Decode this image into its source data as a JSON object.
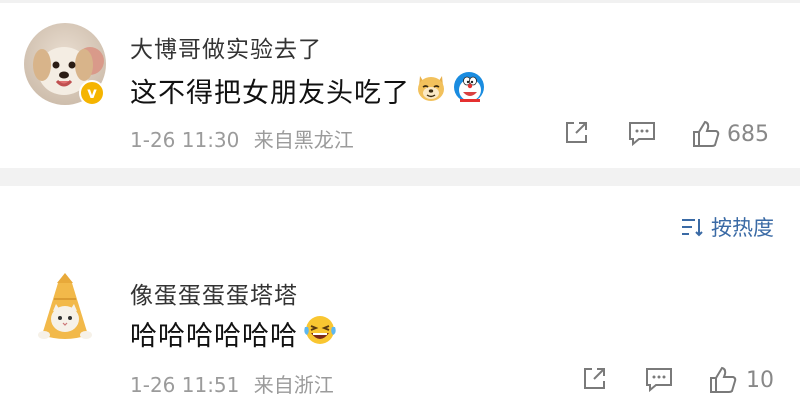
{
  "comments": [
    {
      "username": "大博哥做实验去了",
      "text": "这不得把女朋友头吃了",
      "time": "1-26 11:30",
      "location": "来自黑龙江",
      "likes": "685",
      "verified_badge": "v",
      "emojis": [
        "doge-emoji",
        "doraemon-emoji"
      ]
    },
    {
      "username": "像蛋蛋蛋蛋塔塔",
      "text": "哈哈哈哈哈哈",
      "time": "1-26 11:51",
      "location": "来自浙江",
      "likes": "10",
      "emojis": [
        "laugh-tears-emoji"
      ]
    }
  ],
  "sort": {
    "label": "按热度",
    "icon": "sort-icon"
  },
  "colors": {
    "link": "#3a6aa5",
    "meta": "#9b9b9b",
    "badge": "#f5b400"
  }
}
